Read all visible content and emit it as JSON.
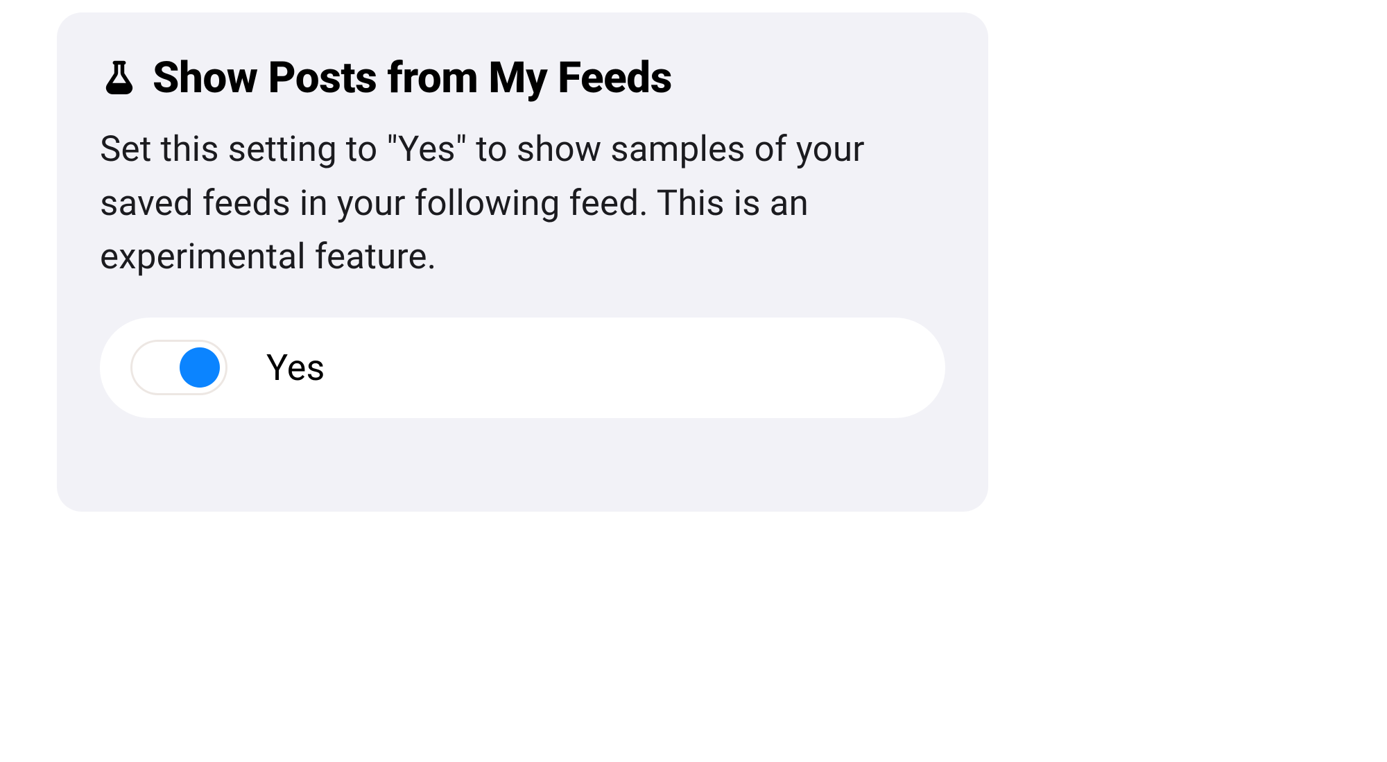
{
  "setting": {
    "icon": "flask-icon",
    "title": "Show Posts from My Feeds",
    "description": "Set this setting to \"Yes\" to show samples of your saved feeds in your following feed. This is an experimental feature.",
    "option": {
      "label": "Yes",
      "state": "on",
      "accent_color": "#0b84ff"
    }
  }
}
